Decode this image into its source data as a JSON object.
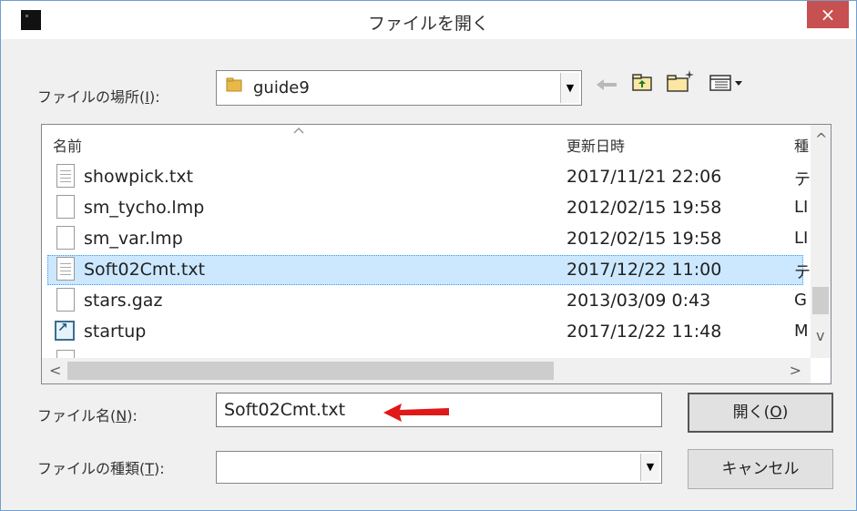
{
  "window": {
    "title": "ファイルを開く",
    "close_glyph": "×"
  },
  "location": {
    "label": "ファイルの場所(",
    "accel": "I",
    "label_end": "):",
    "value": "guide9",
    "dropdown_glyph": "▼"
  },
  "toolbar": {
    "back_icon": "back-arrow-icon",
    "up_icon": "up-folder-icon",
    "new_folder_icon": "new-folder-icon",
    "view_icon": "view-menu-icon"
  },
  "columns": {
    "name": "名前",
    "modified": "更新日時",
    "type": "種"
  },
  "files": [
    {
      "name": "showpick.txt",
      "modified": "2017/11/21 22:06",
      "type": "テ",
      "icon": "text-file-icon",
      "selected": false
    },
    {
      "name": "sm_tycho.lmp",
      "modified": "2012/02/15 19:58",
      "type": "LI",
      "icon": "file-icon",
      "selected": false
    },
    {
      "name": "sm_var.lmp",
      "modified": "2012/02/15 19:58",
      "type": "LI",
      "icon": "file-icon",
      "selected": false
    },
    {
      "name": "Soft02Cmt.txt",
      "modified": "2017/12/22 11:00",
      "type": "テ",
      "icon": "text-file-icon",
      "selected": true
    },
    {
      "name": "stars.gaz",
      "modified": "2013/03/09 0:43",
      "type": "G",
      "icon": "file-icon",
      "selected": false
    },
    {
      "name": "startup",
      "modified": "2017/12/22 11:48",
      "type": "M",
      "icon": "shortcut-icon",
      "selected": false
    }
  ],
  "filename": {
    "label": "ファイル名(",
    "accel": "N",
    "label_end": "):",
    "value": "Soft02Cmt.txt"
  },
  "filetype": {
    "label": "ファイルの種類(",
    "accel": "T",
    "label_end": "):",
    "value": "",
    "dropdown_glyph": "▼"
  },
  "buttons": {
    "open_label": "開く(",
    "open_accel": "O",
    "open_end": ")",
    "cancel_label": "キャンセル"
  },
  "scroll": {
    "up": "^",
    "down": "v",
    "left": "<",
    "right": ">"
  },
  "colors": {
    "selection": "#cce8ff",
    "close_button": "#c75050",
    "annotation_arrow": "#e01818"
  }
}
